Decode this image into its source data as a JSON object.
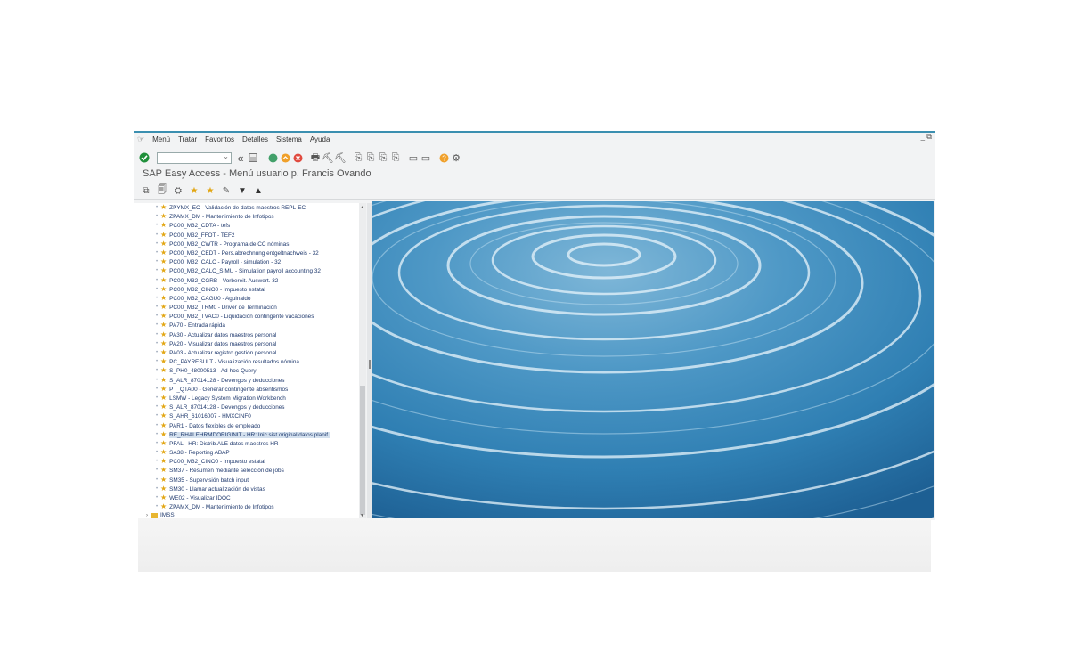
{
  "menu": [
    "Menú",
    "Tratar",
    "Favoritos",
    "Detalles",
    "Sistema",
    "Ayuda"
  ],
  "window_controls": "_ ⧉",
  "toolbar": {
    "enter_icon": "check-circle-icon",
    "command_field_value": "",
    "back_icon": "double-left-icon",
    "save_icon": "save-icon"
  },
  "title": "SAP Easy Access  -  Menú usuario p. Francis Ovando",
  "tree": [
    {
      "text": "ZPYMX_EC - Validación de datos maestros REPL-EC"
    },
    {
      "text": "ZPAMX_DM - Mantenimiento de Infotipos"
    },
    {
      "text": "PC00_M32_CDTA - tefs"
    },
    {
      "text": "PC00_M32_FFOT - TEF2"
    },
    {
      "text": "PC00_M32_CWTR - Programa de CC nóminas"
    },
    {
      "text": "PC00_M32_CEDT - Pers.abrechnung entgeltnachweis - 32"
    },
    {
      "text": "PC00_M32_CALC - Payroll - simulation - 32"
    },
    {
      "text": "PC00_M32_CALC_SIMU - Simulation payroll accounting 32"
    },
    {
      "text": "PC00_M32_CGRB - Vorbereit. Auswert.            32"
    },
    {
      "text": "PC00_M32_CINO0 - Impuesto estatal"
    },
    {
      "text": "PC00_M32_CAGU0 - Aguinaldo"
    },
    {
      "text": "PC00_M32_TRM0 - Driver de Terminación"
    },
    {
      "text": "PC00_M32_TVAC0 - Liquidación contingente vacaciones"
    },
    {
      "text": "PA70 - Entrada rápida"
    },
    {
      "text": "PA30 - Actualizar datos maestros personal"
    },
    {
      "text": "PA20 - Visualizar datos maestros personal"
    },
    {
      "text": "PA03 - Actualizar registro gestión personal"
    },
    {
      "text": "PC_PAYRESULT - Visualización resultados nómina"
    },
    {
      "text": "S_PH0_48000513 - Ad-hoc-Query"
    },
    {
      "text": "S_ALR_87014128 - Devengos y deducciones"
    },
    {
      "text": "PT_QTA00 - Generar contingente absentismos"
    },
    {
      "text": "LSMW - Legacy System Migration Workbench"
    },
    {
      "text": "S_ALR_87014128 - Devengos y deducciones"
    },
    {
      "text": "S_AHR_61016007 - HMXCINF0"
    },
    {
      "text": "PAR1 - Datos flexibles de empleado"
    },
    {
      "text": "RE_RHALEHRMDORIGINIT - HR: Inic.sist.original datos planif.",
      "selected": true
    },
    {
      "text": "PFAL - HR: Distrib.ALE datos maestros HR"
    },
    {
      "text": "SA38 - Reporting ABAP"
    },
    {
      "text": "PC00_M32_CINO0 - Impuesto estatal"
    },
    {
      "text": "SM37 - Resumen mediante selección de jobs"
    },
    {
      "text": "SM35 - Supervisión batch input"
    },
    {
      "text": "SM30 - Llamar actualización de vistas"
    },
    {
      "text": "WE02 - Visualizar IDOC"
    },
    {
      "text": "ZPAMX_DM - Mantenimiento de Infotipos"
    }
  ],
  "folder": {
    "label": "IMSS"
  },
  "colors": {
    "accent": "#3b8fb0",
    "link": "#203a6e",
    "star": "#e2a613",
    "water": "#2f7fb3"
  }
}
